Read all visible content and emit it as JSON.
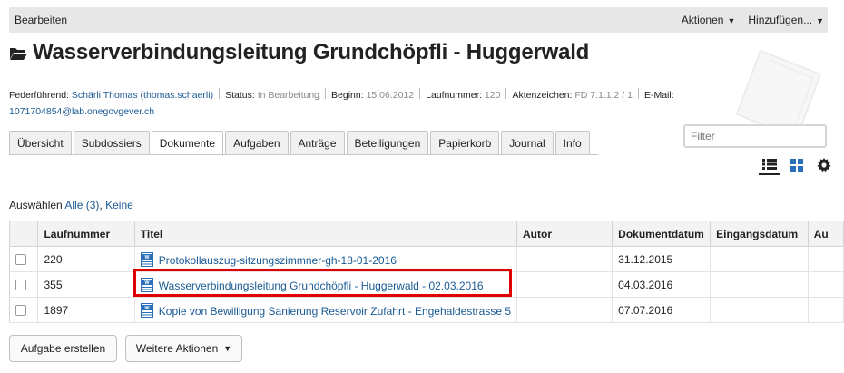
{
  "topbar": {
    "edit": "Bearbeiten",
    "actions": "Aktionen",
    "add": "Hinzufügen..."
  },
  "title": "Wasserverbindungsleitung Grundchöpfli - Huggerwald",
  "meta": {
    "lead_label": "Federführend:",
    "lead_value": "Schärli Thomas (thomas.schaerli)",
    "status_label": "Status:",
    "status_value": "In Bearbeitung",
    "start_label": "Beginn:",
    "start_value": "15.06.2012",
    "number_label": "Laufnummer:",
    "number_value": "120",
    "ref_label": "Aktenzeichen:",
    "ref_value": "FD 7.1.1.2 / 1",
    "email_label": "E-Mail:",
    "email_value": "1071704854@lab.onegovgever.ch"
  },
  "tabs": [
    "Übersicht",
    "Subdossiers",
    "Dokumente",
    "Aufgaben",
    "Anträge",
    "Beteiligungen",
    "Papierkorb",
    "Journal",
    "Info"
  ],
  "filter_placeholder": "Filter",
  "select": {
    "label": "Auswählen",
    "all": "Alle (3)",
    "comma": ",",
    "none": "Keine"
  },
  "table": {
    "headers": [
      "Laufnummer",
      "Titel",
      "Autor",
      "Dokumentdatum",
      "Eingangsdatum",
      "Au"
    ],
    "rows": [
      {
        "number": "220",
        "title": "Protokollauszug-sitzungszimmner-gh-18-01-2016",
        "author": "",
        "date": "31.12.2015",
        "received": ""
      },
      {
        "number": "355",
        "title": "Wasserverbindungsleitung Grundchöpfli - Huggerwald - 02.03.2016",
        "author": "",
        "date": "04.03.2016",
        "received": ""
      },
      {
        "number": "1897",
        "title": "Kopie von Bewilligung Sanierung Reservoir Zufahrt - Engehaldestrasse 5",
        "author": "",
        "date": "07.07.2016",
        "received": ""
      }
    ]
  },
  "buttons": {
    "create_task": "Aufgabe erstellen",
    "more_actions": "Weitere Aktionen"
  },
  "colors": {
    "link": "#1a5a94",
    "highlight": "#e10000",
    "topbar": "#e7e7e7"
  }
}
